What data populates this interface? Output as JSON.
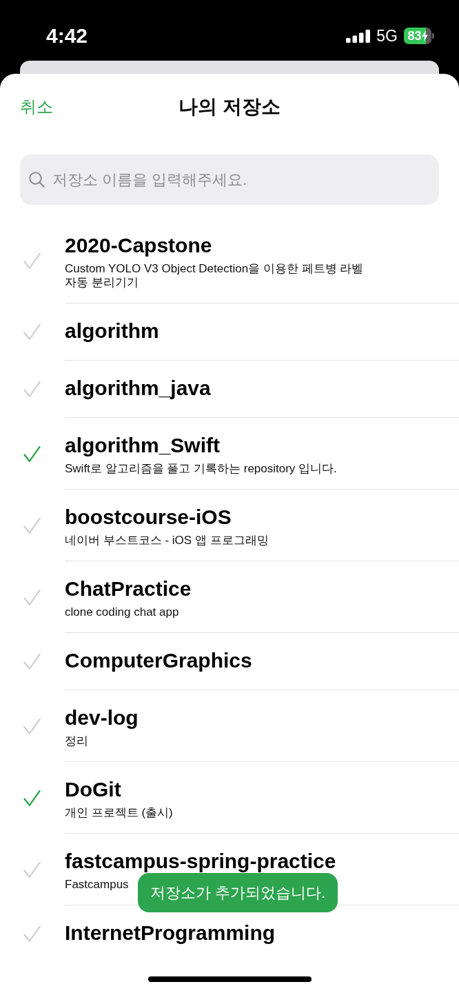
{
  "status_bar": {
    "time": "4:42",
    "network": "5G",
    "battery": "83"
  },
  "header": {
    "cancel": "취소",
    "title": "나의 저장소"
  },
  "search": {
    "placeholder": "저장소 이름을 입력해주세요."
  },
  "repositories": [
    {
      "name": "2020-Capstone",
      "description": "Custom YOLO V3 Object Detection을 이용한 페트병 라벨 자동 분리기기",
      "checked": false
    },
    {
      "name": "algorithm",
      "checked": false
    },
    {
      "name": "algorithm_java",
      "checked": false
    },
    {
      "name": "algorithm_Swift",
      "description": "Swift로 알고리즘을 풀고 기록하는 repository 입니다.",
      "checked": true
    },
    {
      "name": "boostcourse-iOS",
      "description": "네이버 부스트코스 - iOS 앱 프로그래밍",
      "checked": false
    },
    {
      "name": "ChatPractice",
      "description": "clone coding chat app",
      "checked": false
    },
    {
      "name": "ComputerGraphics",
      "checked": false
    },
    {
      "name": "dev-log",
      "description": "정리",
      "checked": false
    },
    {
      "name": "DoGit",
      "description": "개인 프로젝트 (출시)",
      "checked": true
    },
    {
      "name": "fastcampus-spring-practice",
      "description": "Fastcampus",
      "checked": false
    },
    {
      "name": "InternetProgramming",
      "checked": false
    }
  ],
  "toast": {
    "message": "저장소가 추가되었습니다."
  }
}
